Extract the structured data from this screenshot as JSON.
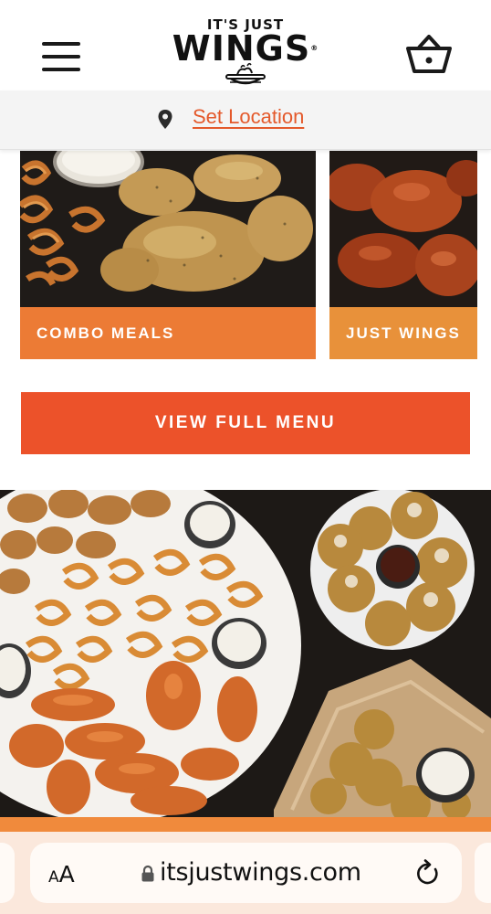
{
  "header": {
    "logo_top": "IT'S JUST",
    "logo_main": "WINGS",
    "logo_reg": "®"
  },
  "location": {
    "link_label": "Set Location"
  },
  "categories": [
    {
      "label": "COMBO MEALS"
    },
    {
      "label": "JUST WINGS"
    }
  ],
  "cta": {
    "label": "VIEW FULL MENU"
  },
  "browser": {
    "text_size_small": "A",
    "text_size_big": "A",
    "url": "itsjustwings.com"
  },
  "colors": {
    "brand_orange": "#ec7b35",
    "cta_red": "#ec522a",
    "link_color": "#e4592b"
  },
  "icons": [
    "hamburger-menu-icon",
    "basket-icon",
    "location-pin-icon",
    "lock-icon",
    "reload-icon"
  ]
}
